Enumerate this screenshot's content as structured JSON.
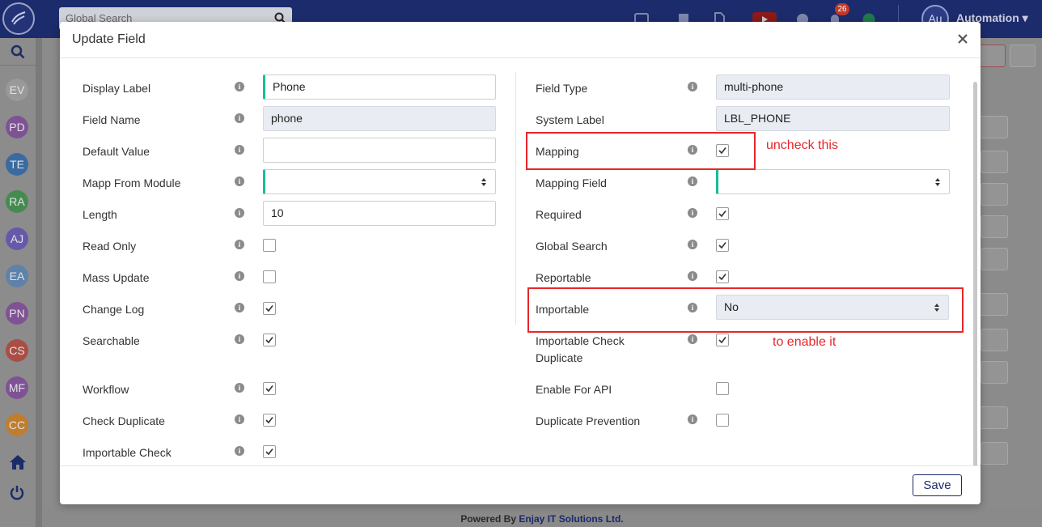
{
  "topbar": {
    "search_placeholder": "Global Search",
    "notification_count": "26",
    "user_initials": "Au",
    "user_name": "Automation ▾"
  },
  "sidebar": {
    "avatars": [
      {
        "initials": "EV",
        "color": "#9e9e9e"
      },
      {
        "initials": "PD",
        "color": "#7b3f98"
      },
      {
        "initials": "TE",
        "color": "#1f5fa8"
      },
      {
        "initials": "RA",
        "color": "#2e8b3e"
      },
      {
        "initials": "AJ",
        "color": "#5b49b5"
      },
      {
        "initials": "EA",
        "color": "#4f7fb3"
      },
      {
        "initials": "PN",
        "color": "#7b3f98"
      },
      {
        "initials": "CS",
        "color": "#b53a2e"
      },
      {
        "initials": "MF",
        "color": "#7b3f98"
      },
      {
        "initials": "CC",
        "color": "#d07a10"
      }
    ]
  },
  "modal": {
    "title": "Update Field",
    "save_label": "Save",
    "left_fields": [
      {
        "label": "Display Label",
        "type": "text",
        "value": "Phone",
        "accent": true
      },
      {
        "label": "Field Name",
        "type": "readonly",
        "value": "phone"
      },
      {
        "label": "Default Value",
        "type": "text",
        "value": ""
      },
      {
        "label": "Mapp From Module",
        "type": "select",
        "value": "",
        "accent": true
      },
      {
        "label": "Length",
        "type": "text",
        "value": "10"
      },
      {
        "label": "Read Only",
        "type": "checkbox",
        "checked": false
      },
      {
        "label": "Mass Update",
        "type": "checkbox",
        "checked": false
      },
      {
        "label": "Change Log",
        "type": "checkbox",
        "checked": true
      },
      {
        "label": "Searchable",
        "type": "checkbox",
        "checked": true
      },
      {
        "label": "Workflow",
        "type": "checkbox",
        "checked": true
      },
      {
        "label": "Check Duplicate",
        "type": "checkbox",
        "checked": true
      },
      {
        "label": "Importable Check",
        "type": "checkbox",
        "checked": true
      }
    ],
    "right_fields": [
      {
        "label": "Field Type",
        "type": "readonly",
        "value": "multi-phone"
      },
      {
        "label": "System Label",
        "type": "readonly",
        "value": "LBL_PHONE",
        "no_info": true
      },
      {
        "label": "Mapping",
        "type": "checkbox",
        "checked": true
      },
      {
        "label": "Mapping Field",
        "type": "select",
        "value": "",
        "accent": true
      },
      {
        "label": "Required",
        "type": "checkbox",
        "checked": true
      },
      {
        "label": "Global Search",
        "type": "checkbox",
        "checked": true
      },
      {
        "label": "Reportable",
        "type": "checkbox",
        "checked": true
      },
      {
        "label": "Importable",
        "type": "select",
        "value": "No",
        "readonly": true
      },
      {
        "label": "Importable Check Duplicate",
        "type": "checkbox",
        "checked": true
      },
      {
        "label": "Enable For API",
        "type": "checkbox",
        "checked": false,
        "no_info": true
      },
      {
        "label": "Duplicate Prevention",
        "type": "checkbox",
        "checked": false
      }
    ]
  },
  "annotations": {
    "mapping_note": "uncheck this",
    "importable_note": "to enable it"
  },
  "footer": {
    "powered_by": "Powered By ",
    "company": "Enjay IT Solutions Ltd."
  }
}
